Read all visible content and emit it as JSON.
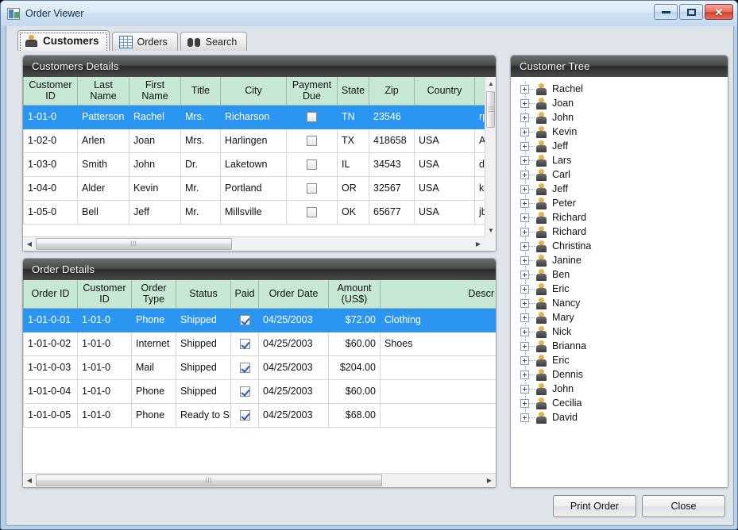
{
  "window": {
    "title": "Order Viewer",
    "app_icon": "app-window-icon",
    "controls": {
      "minimize": "Minimize",
      "maximize": "Maximize",
      "close": "Close"
    }
  },
  "tabs": [
    {
      "label": "Customers",
      "icon": "person-icon",
      "active": true
    },
    {
      "label": "Orders",
      "icon": "grid-icon",
      "active": false
    },
    {
      "label": "Search",
      "icon": "binoculars-icon",
      "active": false
    }
  ],
  "customers_panel": {
    "title": "Customers Details",
    "columns": [
      "Customer ID",
      "Last Name",
      "First Name",
      "Title",
      "City",
      "Payment Due",
      "State",
      "Zip",
      "Country",
      ""
    ],
    "rows": [
      {
        "selected": true,
        "cells": [
          "1-01-0",
          "Patterson",
          "Rachel",
          "Mrs.",
          "Richarson",
          "",
          "TN",
          "23546",
          "",
          "rp"
        ]
      },
      {
        "selected": false,
        "cells": [
          "1-02-0",
          "Arlen",
          "Joan",
          "Mrs.",
          "Harlingen",
          "",
          "TX",
          "418658",
          "USA",
          "Ar"
        ]
      },
      {
        "selected": false,
        "cells": [
          "1-03-0",
          "Smith",
          "John",
          "Dr.",
          "Laketown",
          "",
          "IL",
          "34543",
          "USA",
          "da"
        ]
      },
      {
        "selected": false,
        "cells": [
          "1-04-0",
          "Alder",
          "Kevin",
          "Mr.",
          "Portland",
          "",
          "OR",
          "32567",
          "USA",
          "ke"
        ]
      },
      {
        "selected": false,
        "cells": [
          "1-05-0",
          "Bell",
          "Jeff",
          "Mr.",
          "Millsville",
          "",
          "OK",
          "65677",
          "USA",
          "jb"
        ]
      }
    ],
    "payment_due_checked": [
      false,
      false,
      false,
      false,
      false
    ]
  },
  "orders_panel": {
    "title": "Order Details",
    "columns": [
      "Order ID",
      "Customer ID",
      "Order Type",
      "Status",
      "Paid",
      "Order Date",
      "Amount (US$)",
      "Descr"
    ],
    "rows": [
      {
        "selected": true,
        "paid": true,
        "cells": [
          "1-01-0-01",
          "1-01-0",
          "Phone",
          "Shipped",
          "",
          "04/25/2003",
          "$72.00",
          "Clothing"
        ]
      },
      {
        "selected": false,
        "paid": true,
        "cells": [
          "1-01-0-02",
          "1-01-0",
          "Internet",
          "Shipped",
          "",
          "04/25/2003",
          "$60.00",
          "Shoes"
        ]
      },
      {
        "selected": false,
        "paid": true,
        "cells": [
          "1-01-0-03",
          "1-01-0",
          "Mail",
          "Shipped",
          "",
          "04/25/2003",
          "$204.00",
          ""
        ]
      },
      {
        "selected": false,
        "paid": true,
        "cells": [
          "1-01-0-04",
          "1-01-0",
          "Phone",
          "Shipped",
          "",
          "04/25/2003",
          "$60.00",
          ""
        ]
      },
      {
        "selected": false,
        "paid": true,
        "cells": [
          "1-01-0-05",
          "1-01-0",
          "Phone",
          "Ready to Sh",
          "",
          "04/25/2003",
          "$68.00",
          ""
        ]
      }
    ]
  },
  "tree_panel": {
    "title": "Customer Tree",
    "nodes": [
      "Rachel",
      "Joan",
      "John",
      "Kevin",
      "Jeff",
      "Lars",
      "Carl",
      "Jeff",
      "Peter",
      "Richard",
      "Richard",
      "Christina",
      "Janine",
      "Ben",
      "Eric",
      "Nancy",
      "Mary",
      "Nick",
      "Brianna",
      "Eric",
      "Dennis",
      "John",
      "Cecilia",
      "David"
    ]
  },
  "footer": {
    "print_order_label": "Print Order",
    "close_label": "Close"
  },
  "colors": {
    "selection": "#2b96f1",
    "column_header": "#c7e8d3",
    "panel_header_dark": "#2c2c2c",
    "window_chrome": "#dfe4ea"
  }
}
